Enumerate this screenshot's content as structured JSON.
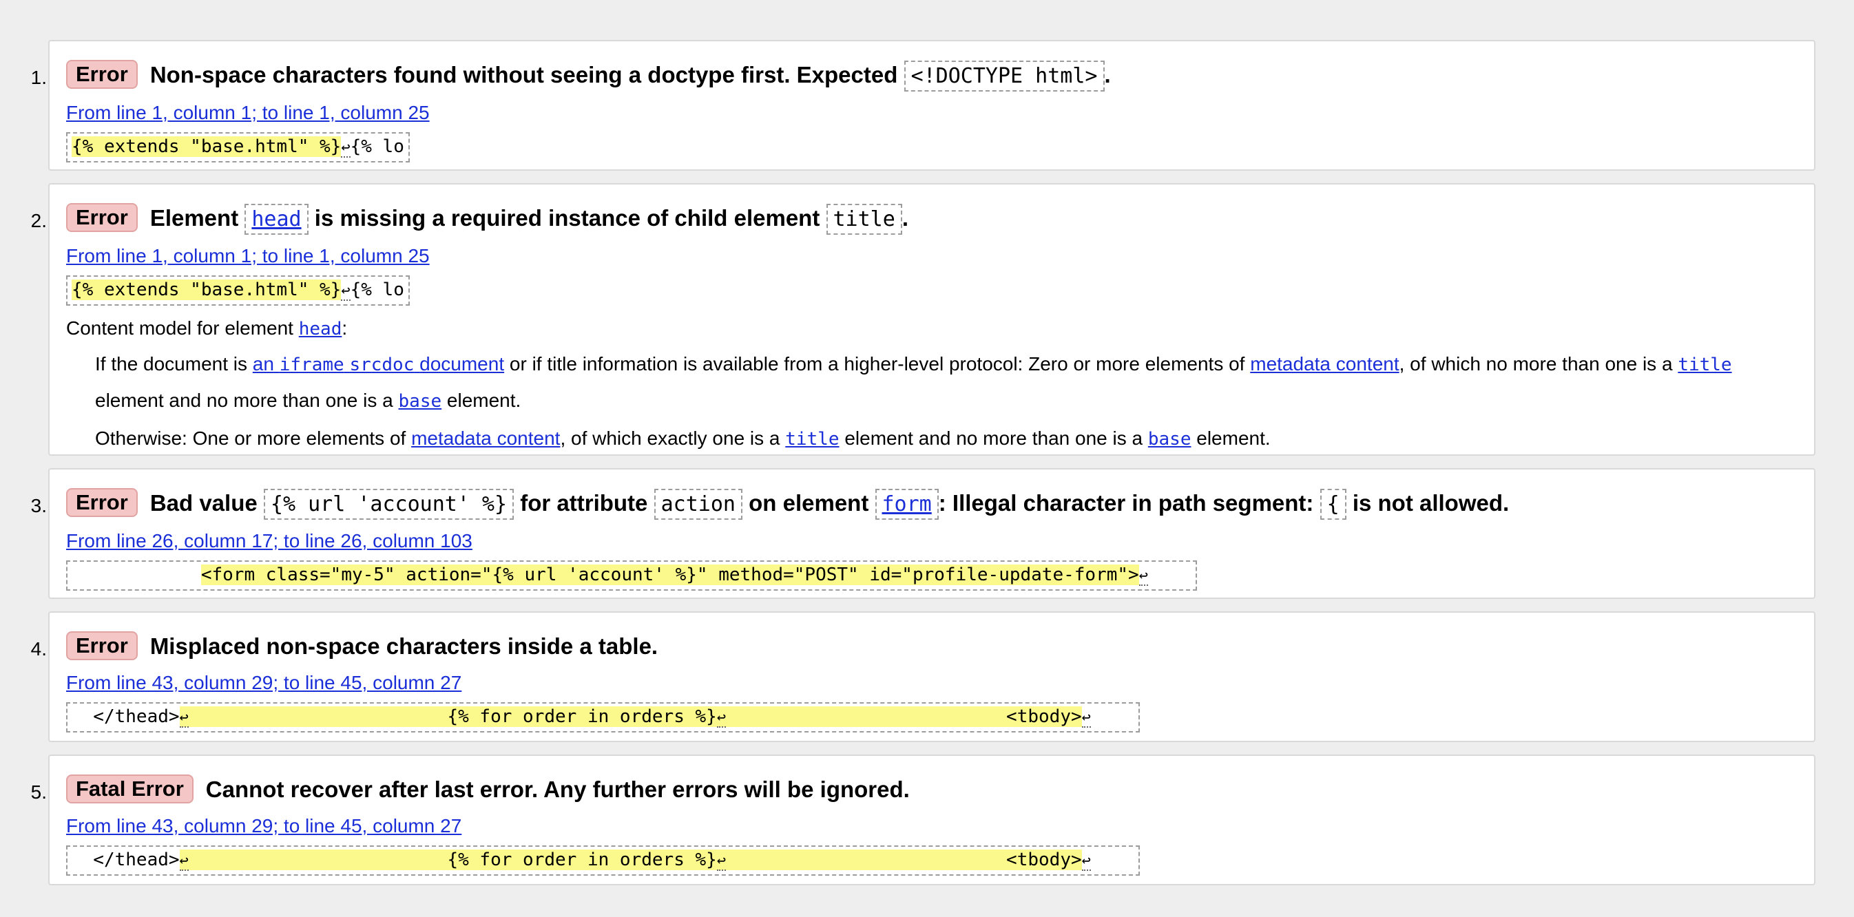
{
  "messages": [
    {
      "number": "1.",
      "type": "Error",
      "text_1": "Non-space characters found without seeing a doctype first. Expected",
      "code_1": "<!DOCTYPE html>",
      "text_2": ".",
      "location": "From line 1, column 1; to line 1, column 25",
      "extract_hl": "{% extends \"base.html\" %}",
      "extract_rest": "{% lo"
    },
    {
      "number": "2.",
      "type": "Error",
      "text_1": "Element",
      "code_1": "head",
      "text_2": "is missing a required instance of child element",
      "code_2": "title",
      "text_3": ".",
      "location": "From line 1, column 1; to line 1, column 25",
      "extract_hl": "{% extends \"base.html\" %}",
      "extract_rest": "{% lo",
      "content_model": {
        "label": "Content model for element",
        "element": "head",
        "colon": ":",
        "p1_a": "If the document is",
        "p1_link_1": "an",
        "p1_link_2": "iframe",
        "p1_link_3": "srcdoc",
        "p1_link_4": "document",
        "p1_b": "or if title information is available from a higher-level protocol: Zero or more elements of",
        "p1_link_5": "metadata content",
        "p1_c": ", of which no more than one is a",
        "p1_code_1": "title",
        "p1_d": "element and no more than one is a",
        "p1_code_2": "base",
        "p1_e": "element.",
        "p2_a": "Otherwise: One or more elements of",
        "p2_link": "metadata content",
        "p2_b": ", of which exactly one is a",
        "p2_code_1": "title",
        "p2_c": "element and no more than one is a",
        "p2_code_2": "base",
        "p2_d": "element."
      }
    },
    {
      "number": "3.",
      "type": "Error",
      "text_1": "Bad value",
      "code_1": "{% url 'account' %}",
      "text_2": "for attribute",
      "code_2": "action",
      "text_3": "on element",
      "code_3": "form",
      "text_4": ": Illegal character in path segment:",
      "code_4": "{",
      "text_5": "is not allowed.",
      "location": "From line 26, column 17; to line 26, column 103",
      "extract_pre": "            ",
      "extract_hl": "<form class=\"my-5\" action=\"{% url 'account' %}\" method=\"POST\" id=\"profile-update-form\">",
      "extract_rest": ""
    },
    {
      "number": "4.",
      "type": "Error",
      "text_1": "Misplaced non-space characters inside a table.",
      "location": "From line 43, column 29; to line 45, column 27",
      "extract_pre": "  </thead>",
      "extract_hl_1": "                        {% for order in orders %}",
      "extract_hl_2": "                          <tbody>",
      "extract_rest": ""
    },
    {
      "number": "5.",
      "type": "Fatal Error",
      "text_1": "Cannot recover after last error. Any further errors will be ignored.",
      "location": "From line 43, column 29; to line 45, column 27",
      "extract_pre": "  </thead>",
      "extract_hl_1": "                        {% for order in orders %}",
      "extract_hl_2": "                          <tbody>",
      "extract_rest": ""
    }
  ],
  "return_glyph": "↩",
  "colors": {
    "badge_bg": "#f5c6c6",
    "highlight": "#fbf98c",
    "link": "#1a2fd8",
    "page_bg": "#eeeeee"
  }
}
